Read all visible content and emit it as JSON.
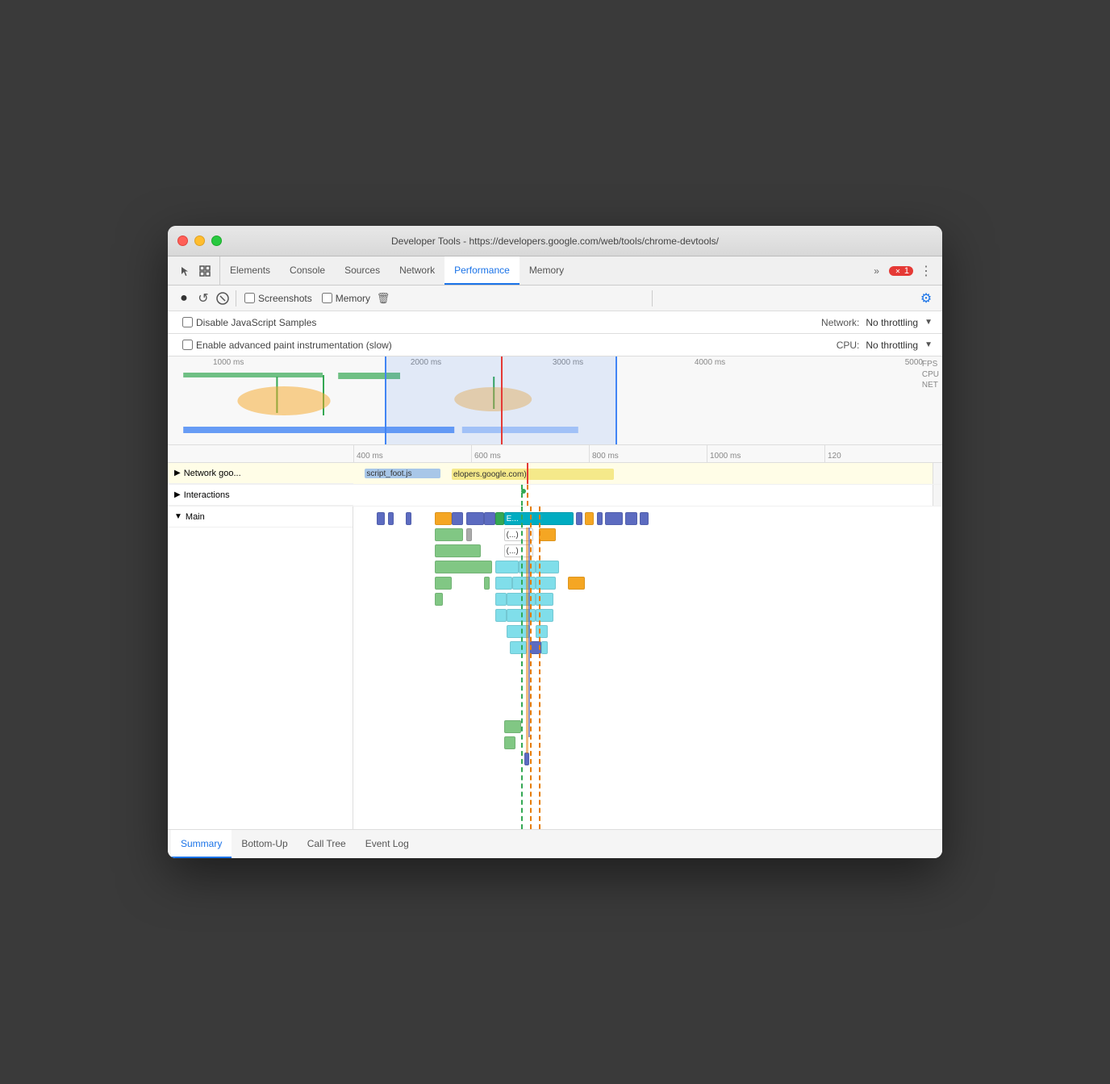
{
  "window": {
    "title": "Developer Tools - https://developers.google.com/web/tools/chrome-devtools/"
  },
  "tabs": [
    {
      "id": "elements",
      "label": "Elements",
      "active": false
    },
    {
      "id": "console",
      "label": "Console",
      "active": false
    },
    {
      "id": "sources",
      "label": "Sources",
      "active": false
    },
    {
      "id": "network",
      "label": "Network",
      "active": false
    },
    {
      "id": "performance",
      "label": "Performance",
      "active": true
    },
    {
      "id": "memory",
      "label": "Memory",
      "active": false
    }
  ],
  "tab_overflow": "»",
  "error_badge": "1",
  "more_menu": "⋮",
  "toolbar": {
    "record_label": "●",
    "reload_label": "↺",
    "clear_label": "🚫",
    "screenshots_label": "Screenshots",
    "memory_label": "Memory",
    "trash_label": "🗑",
    "settings_label": "⚙"
  },
  "options": {
    "js_samples_label": "Disable JavaScript Samples",
    "paint_label": "Enable advanced paint instrumentation (slow)",
    "network_label": "Network:",
    "network_value": "No throttling",
    "cpu_label": "CPU:",
    "cpu_value": "No throttling"
  },
  "overview": {
    "time_labels": [
      "1000 ms",
      "2000 ms",
      "3000 ms",
      "4000 ms",
      "5000"
    ],
    "side_labels": [
      "FPS",
      "CPU",
      "NET"
    ]
  },
  "zoom_ruler": {
    "ticks": [
      "400 ms",
      "600 ms",
      "800 ms",
      "1000 ms",
      "120"
    ]
  },
  "network_row": {
    "label": "▶ Network goo...",
    "blocks": [
      {
        "text": "script_foot.js",
        "color": "#a0c4e8",
        "left": "14%",
        "width": "12%"
      },
      {
        "text": "elopers.google.com)",
        "color": "#f0e0a0",
        "left": "28%",
        "width": "28%"
      }
    ]
  },
  "interactions_row": {
    "label": "▶ Interactions"
  },
  "main_row": {
    "label": "▼ Main"
  },
  "bottom_tabs": [
    {
      "id": "summary",
      "label": "Summary",
      "active": true
    },
    {
      "id": "bottom-up",
      "label": "Bottom-Up",
      "active": false
    },
    {
      "id": "call-tree",
      "label": "Call Tree",
      "active": false
    },
    {
      "id": "event-log",
      "label": "Event Log",
      "active": false
    }
  ],
  "colors": {
    "accent": "#1a73e8",
    "active_tab_underline": "#1a73e8",
    "flame_yellow": "#f5a623",
    "flame_green": "#34a853",
    "flame_blue": "#4285f4",
    "flame_purple": "#673ab7",
    "flame_teal": "#00acc1",
    "flame_orange": "#e67c00",
    "selection": "rgba(66,133,244,0.12)"
  }
}
